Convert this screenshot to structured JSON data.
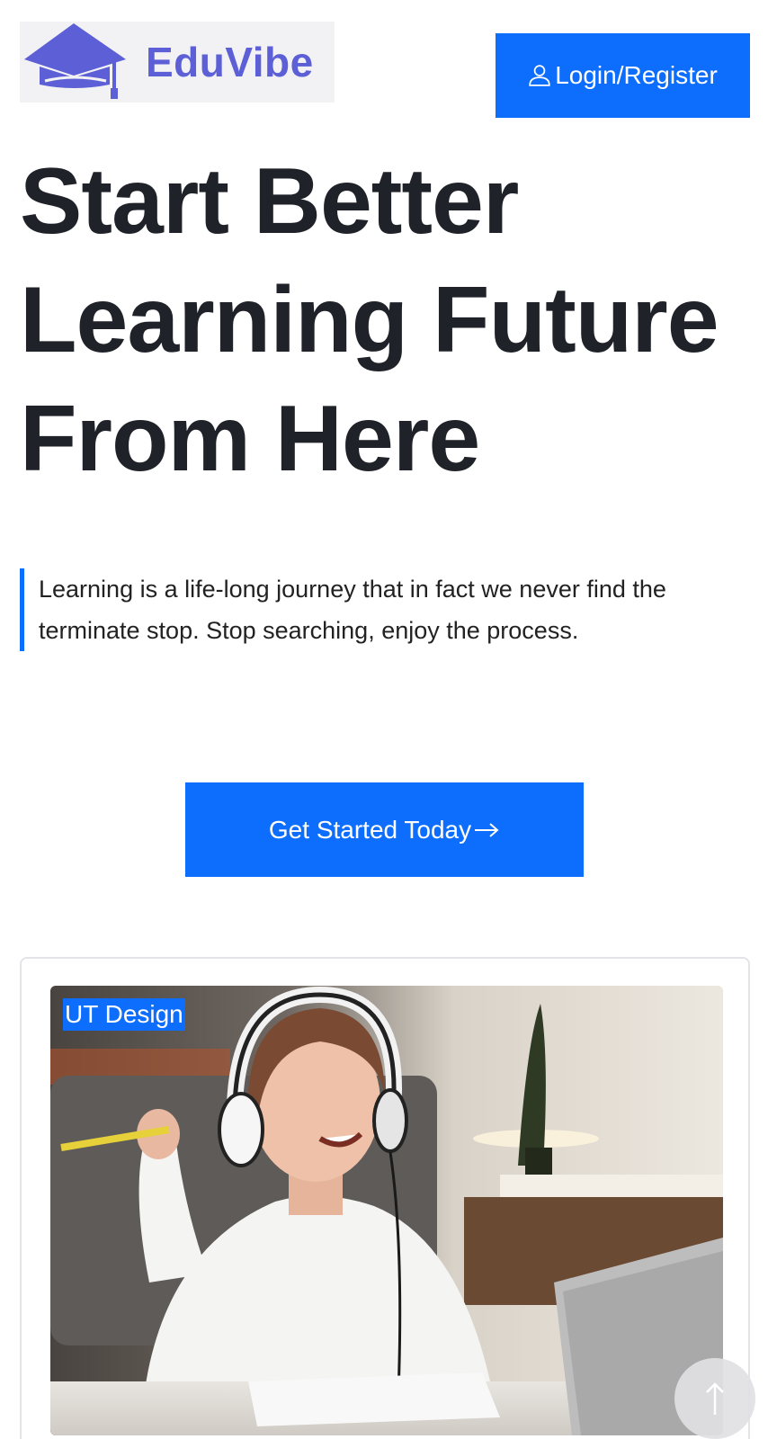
{
  "header": {
    "logo_text": "EduVibe",
    "login_label": "Login/Register"
  },
  "hero": {
    "title_lines": [
      "Start Better",
      "Learning Future",
      "From Here"
    ],
    "quote": "Learning is a life-long journey that in fact we never find the terminate stop. Stop searching, enjoy the process.",
    "cta_label": "Get Started Today"
  },
  "course_card": {
    "category_tag": "UT Design"
  },
  "icons": {
    "logo": "graduation-cap-icon",
    "login": "user-icon",
    "cta": "arrow-right-icon",
    "scroll": "arrow-up-icon"
  },
  "colors": {
    "accent": "#0d6efd",
    "logo": "#5c5fd6",
    "heading": "#1f2229"
  }
}
